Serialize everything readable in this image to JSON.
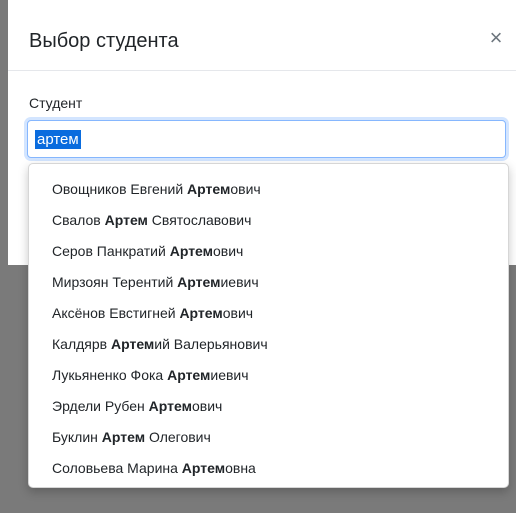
{
  "modal": {
    "title": "Выбор студента",
    "close_label": "×"
  },
  "form": {
    "student_label": "Студент",
    "student_input_value": "артем"
  },
  "dropdown": {
    "items": [
      {
        "before": "Овощников Евгений ",
        "match": "Артем",
        "after": "ович"
      },
      {
        "before": "Свалов ",
        "match": "Артем",
        "after": " Святославович"
      },
      {
        "before": "Серов Панкратий ",
        "match": "Артем",
        "after": "ович"
      },
      {
        "before": "Мирзоян Терентий ",
        "match": "Артем",
        "after": "иевич"
      },
      {
        "before": "Аксёнов Евстигней ",
        "match": "Артем",
        "after": "ович"
      },
      {
        "before": "Калдярв ",
        "match": "Артем",
        "after": "ий Валерьянович"
      },
      {
        "before": "Лукьяненко Фока ",
        "match": "Артем",
        "after": "иевич"
      },
      {
        "before": "Эрдели Рубен ",
        "match": "Артем",
        "after": "ович"
      },
      {
        "before": "Буклин ",
        "match": "Артем",
        "after": " Олегович"
      },
      {
        "before": "Соловьева Марина ",
        "match": "Артем",
        "after": "овна"
      }
    ]
  }
}
